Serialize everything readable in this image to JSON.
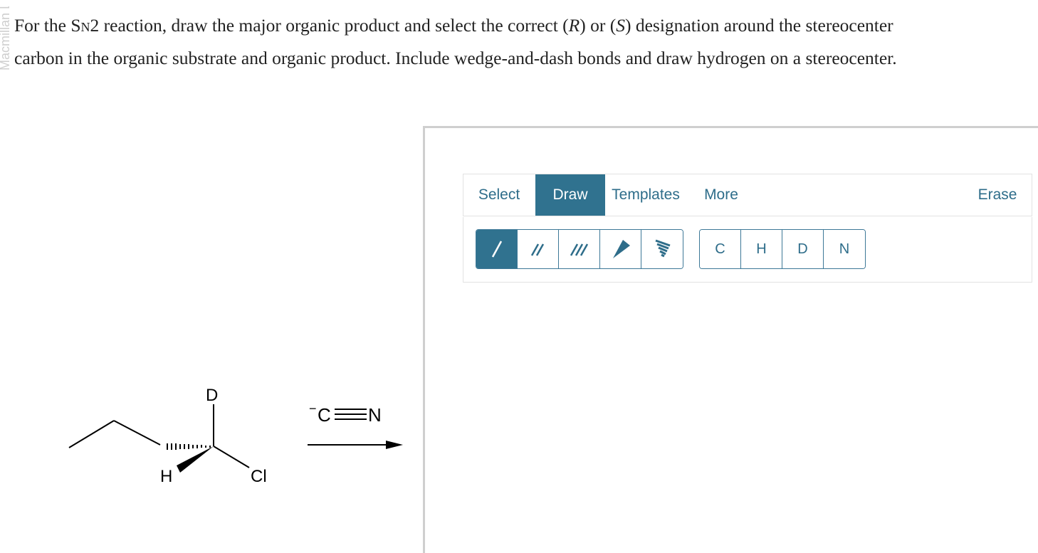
{
  "watermark": "Macmillan Le",
  "question": {
    "part1": "For the S",
    "subscript": "N",
    "part2": "2 reaction, draw the major organic product and select the correct (",
    "R": "R",
    "part3": ") or (",
    "S": "S",
    "part4": ") designation around the stereocenter",
    "line2": "carbon in the organic substrate and organic product. Include wedge-and-dash bonds and draw hydrogen on a stereocenter."
  },
  "scheme": {
    "substrate_labels": {
      "D": "D",
      "H": "H",
      "Cl": "Cl"
    },
    "reagent": "C",
    "reagent_charge": "−",
    "reagent_N": "N"
  },
  "editor": {
    "tabs": [
      {
        "label": "Select",
        "active": false
      },
      {
        "label": "Draw",
        "active": true
      },
      {
        "label": "Templates",
        "active": false
      },
      {
        "label": "More",
        "active": false
      }
    ],
    "erase_label": "Erase",
    "bond_tools": [
      {
        "icon": "single-bond-icon",
        "active": true
      },
      {
        "icon": "double-bond-icon",
        "active": false
      },
      {
        "icon": "triple-bond-icon",
        "active": false
      },
      {
        "icon": "wedge-bond-icon",
        "active": false
      },
      {
        "icon": "hash-bond-icon",
        "active": false
      }
    ],
    "atoms": [
      "C",
      "H",
      "D",
      "N"
    ],
    "accent_color": "#30728f"
  }
}
